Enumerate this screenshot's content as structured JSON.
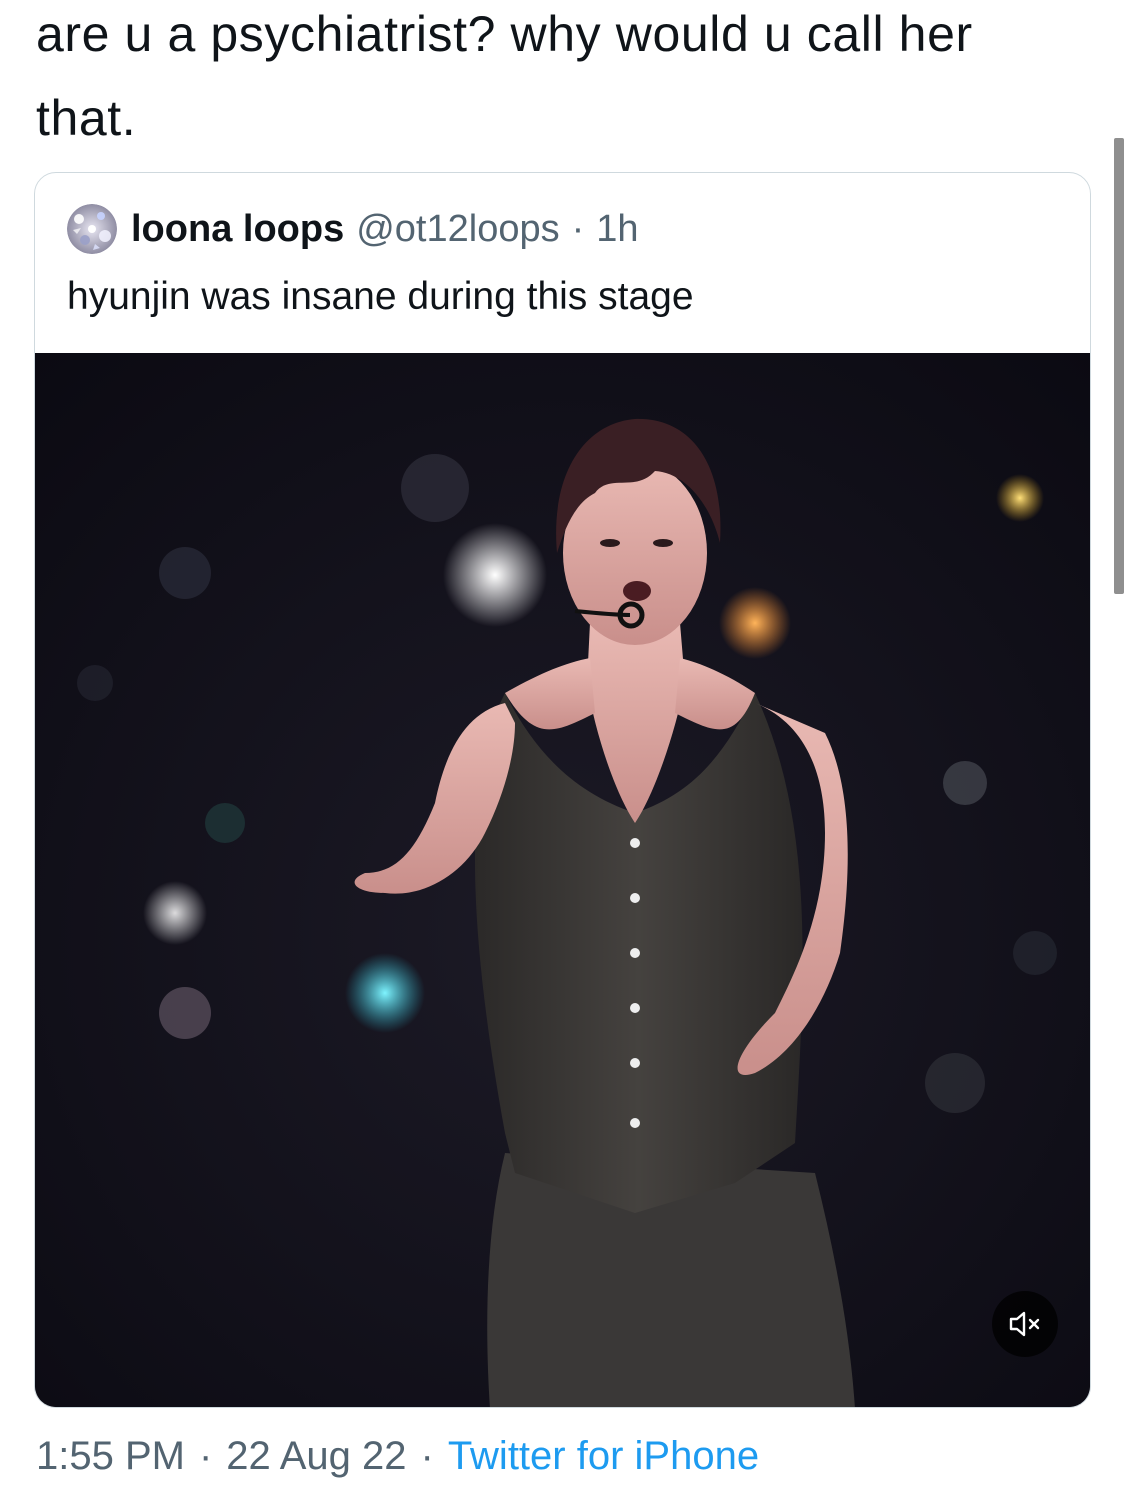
{
  "tweet": {
    "text": "are u a psychiatrist? why would u call her that."
  },
  "quoted_tweet": {
    "display_name": "loona loops",
    "handle": "@ot12loops",
    "separator": "·",
    "age": "1h",
    "text": "hyunjin was insane during this stage",
    "avatar_icon": "sparkle-avatar",
    "media": {
      "kind": "video",
      "mute_icon": "speaker-muted-icon"
    }
  },
  "meta": {
    "time": "1:55 PM",
    "separator": "·",
    "date": "22 Aug 22",
    "source": "Twitter for iPhone"
  },
  "colors": {
    "text": "#0f1419",
    "secondary": "#536471",
    "link": "#1d9bf0",
    "border": "#cfd9de"
  }
}
